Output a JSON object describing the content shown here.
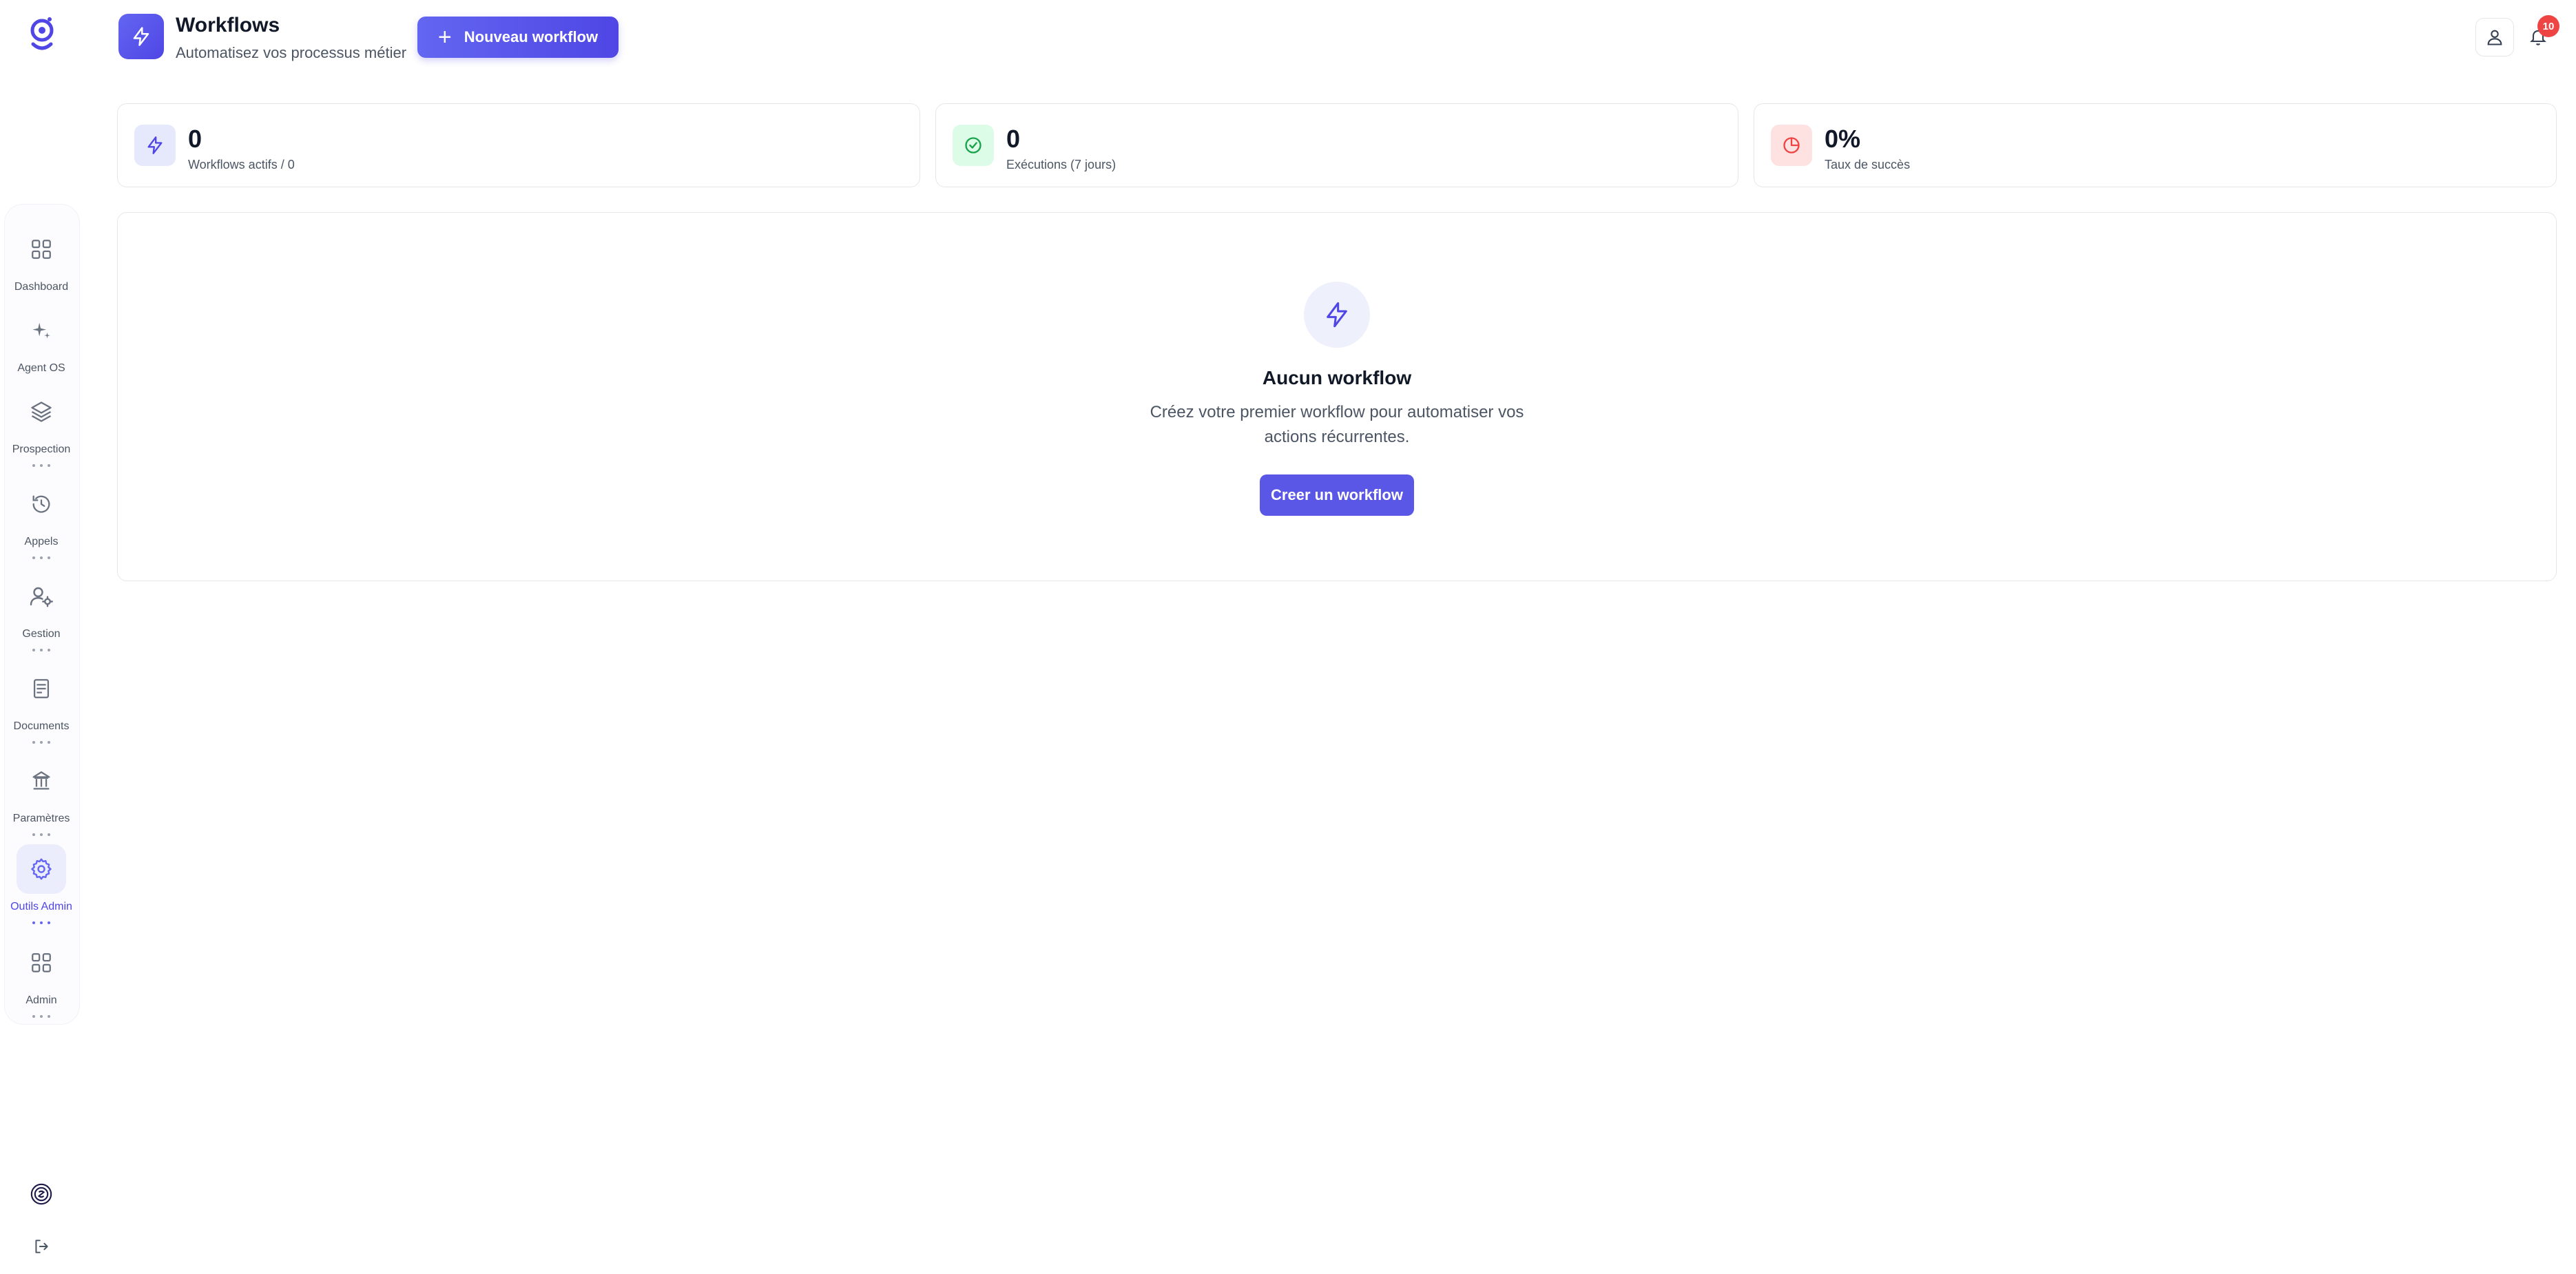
{
  "header": {
    "title": "Workflows",
    "subtitle": "Automatisez vos processus métier",
    "new_button_label": "Nouveau workflow",
    "notification_count": "10"
  },
  "sidebar": {
    "items": [
      {
        "label": "Dashboard",
        "icon": "grid-icon"
      },
      {
        "label": "Agent OS",
        "icon": "sparkle-icon"
      },
      {
        "label": "Prospection",
        "icon": "layers-icon"
      },
      {
        "label": "Appels",
        "icon": "history-icon"
      },
      {
        "label": "Gestion",
        "icon": "user-cog-icon"
      },
      {
        "label": "Documents",
        "icon": "document-icon"
      },
      {
        "label": "Paramètres",
        "icon": "bank-icon"
      },
      {
        "label": "Outils Admin",
        "icon": "gear-icon"
      },
      {
        "label": "Admin",
        "icon": "grid-icon"
      }
    ],
    "active_item": "Outils Admin"
  },
  "stats": [
    {
      "value": "0",
      "label": "Workflows actifs / 0",
      "icon": "lightning-icon"
    },
    {
      "value": "0",
      "label": "Exécutions (7 jours)",
      "icon": "check-circle-icon"
    },
    {
      "value": "0%",
      "label": "Taux de succès",
      "icon": "pie-chart-icon"
    }
  ],
  "empty_state": {
    "title": "Aucun workflow",
    "description": "Créez votre premier workflow pour automatiser vos actions récurrentes.",
    "button_label": "Creer un workflow"
  },
  "colors": {
    "accent": "#4f46e5",
    "accent_light": "#6366f1",
    "success": "#16a34a",
    "danger": "#ef4444"
  }
}
